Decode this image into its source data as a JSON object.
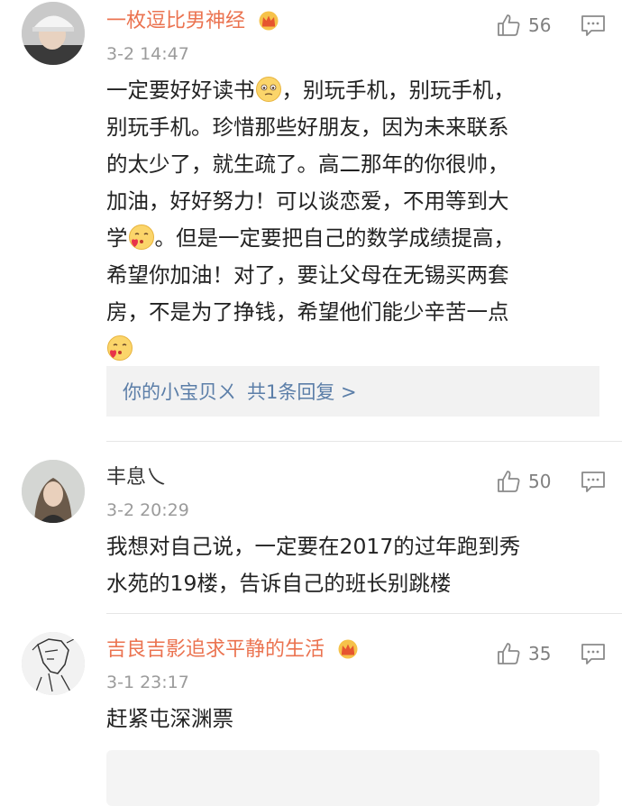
{
  "comments": [
    {
      "name": "一枚逗比男神经",
      "vip": true,
      "time": "3-2 14:47",
      "likes": "56",
      "text_parts": [
        "一定要好好读书",
        "，别玩手机，别玩手机，\n别玩手机。珍惜那些好朋友，因为未来联系\n的太少了，就生疏了。高二那年的你很帅，\n加油，好好努力！可以谈恋爱，不用等到大\n学",
        "。但是一定要把自己的数学成绩提高，\n希望你加油！对了，要让父母在无锡买两套\n房，不是为了挣钱，希望他们能少辛苦一点\n"
      ],
      "reply_user": "你的小宝贝ㄨ",
      "reply_count": "共1条回复 >"
    },
    {
      "name": "丰息乀",
      "vip": false,
      "time": "3-2 20:29",
      "likes": "50",
      "text": "我想对自己说，一定要在2017的过年跑到秀\n水苑的19楼，告诉自己的班长别跳楼"
    },
    {
      "name": "吉良吉影追求平静的生活",
      "vip": true,
      "time": "3-1 23:17",
      "likes": "35",
      "text": "赶紧屯深渊票"
    }
  ],
  "icons": {
    "like": "thumbs-up-icon",
    "reply": "comment-icon",
    "vip": "crown-icon",
    "emoji_sad": "flushed-face-emoji",
    "emoji_love": "blowing-kiss-emoji"
  },
  "colors": {
    "vip_name": "#eb7350",
    "link": "#5b7ea8",
    "meta": "#9b9b9b"
  }
}
